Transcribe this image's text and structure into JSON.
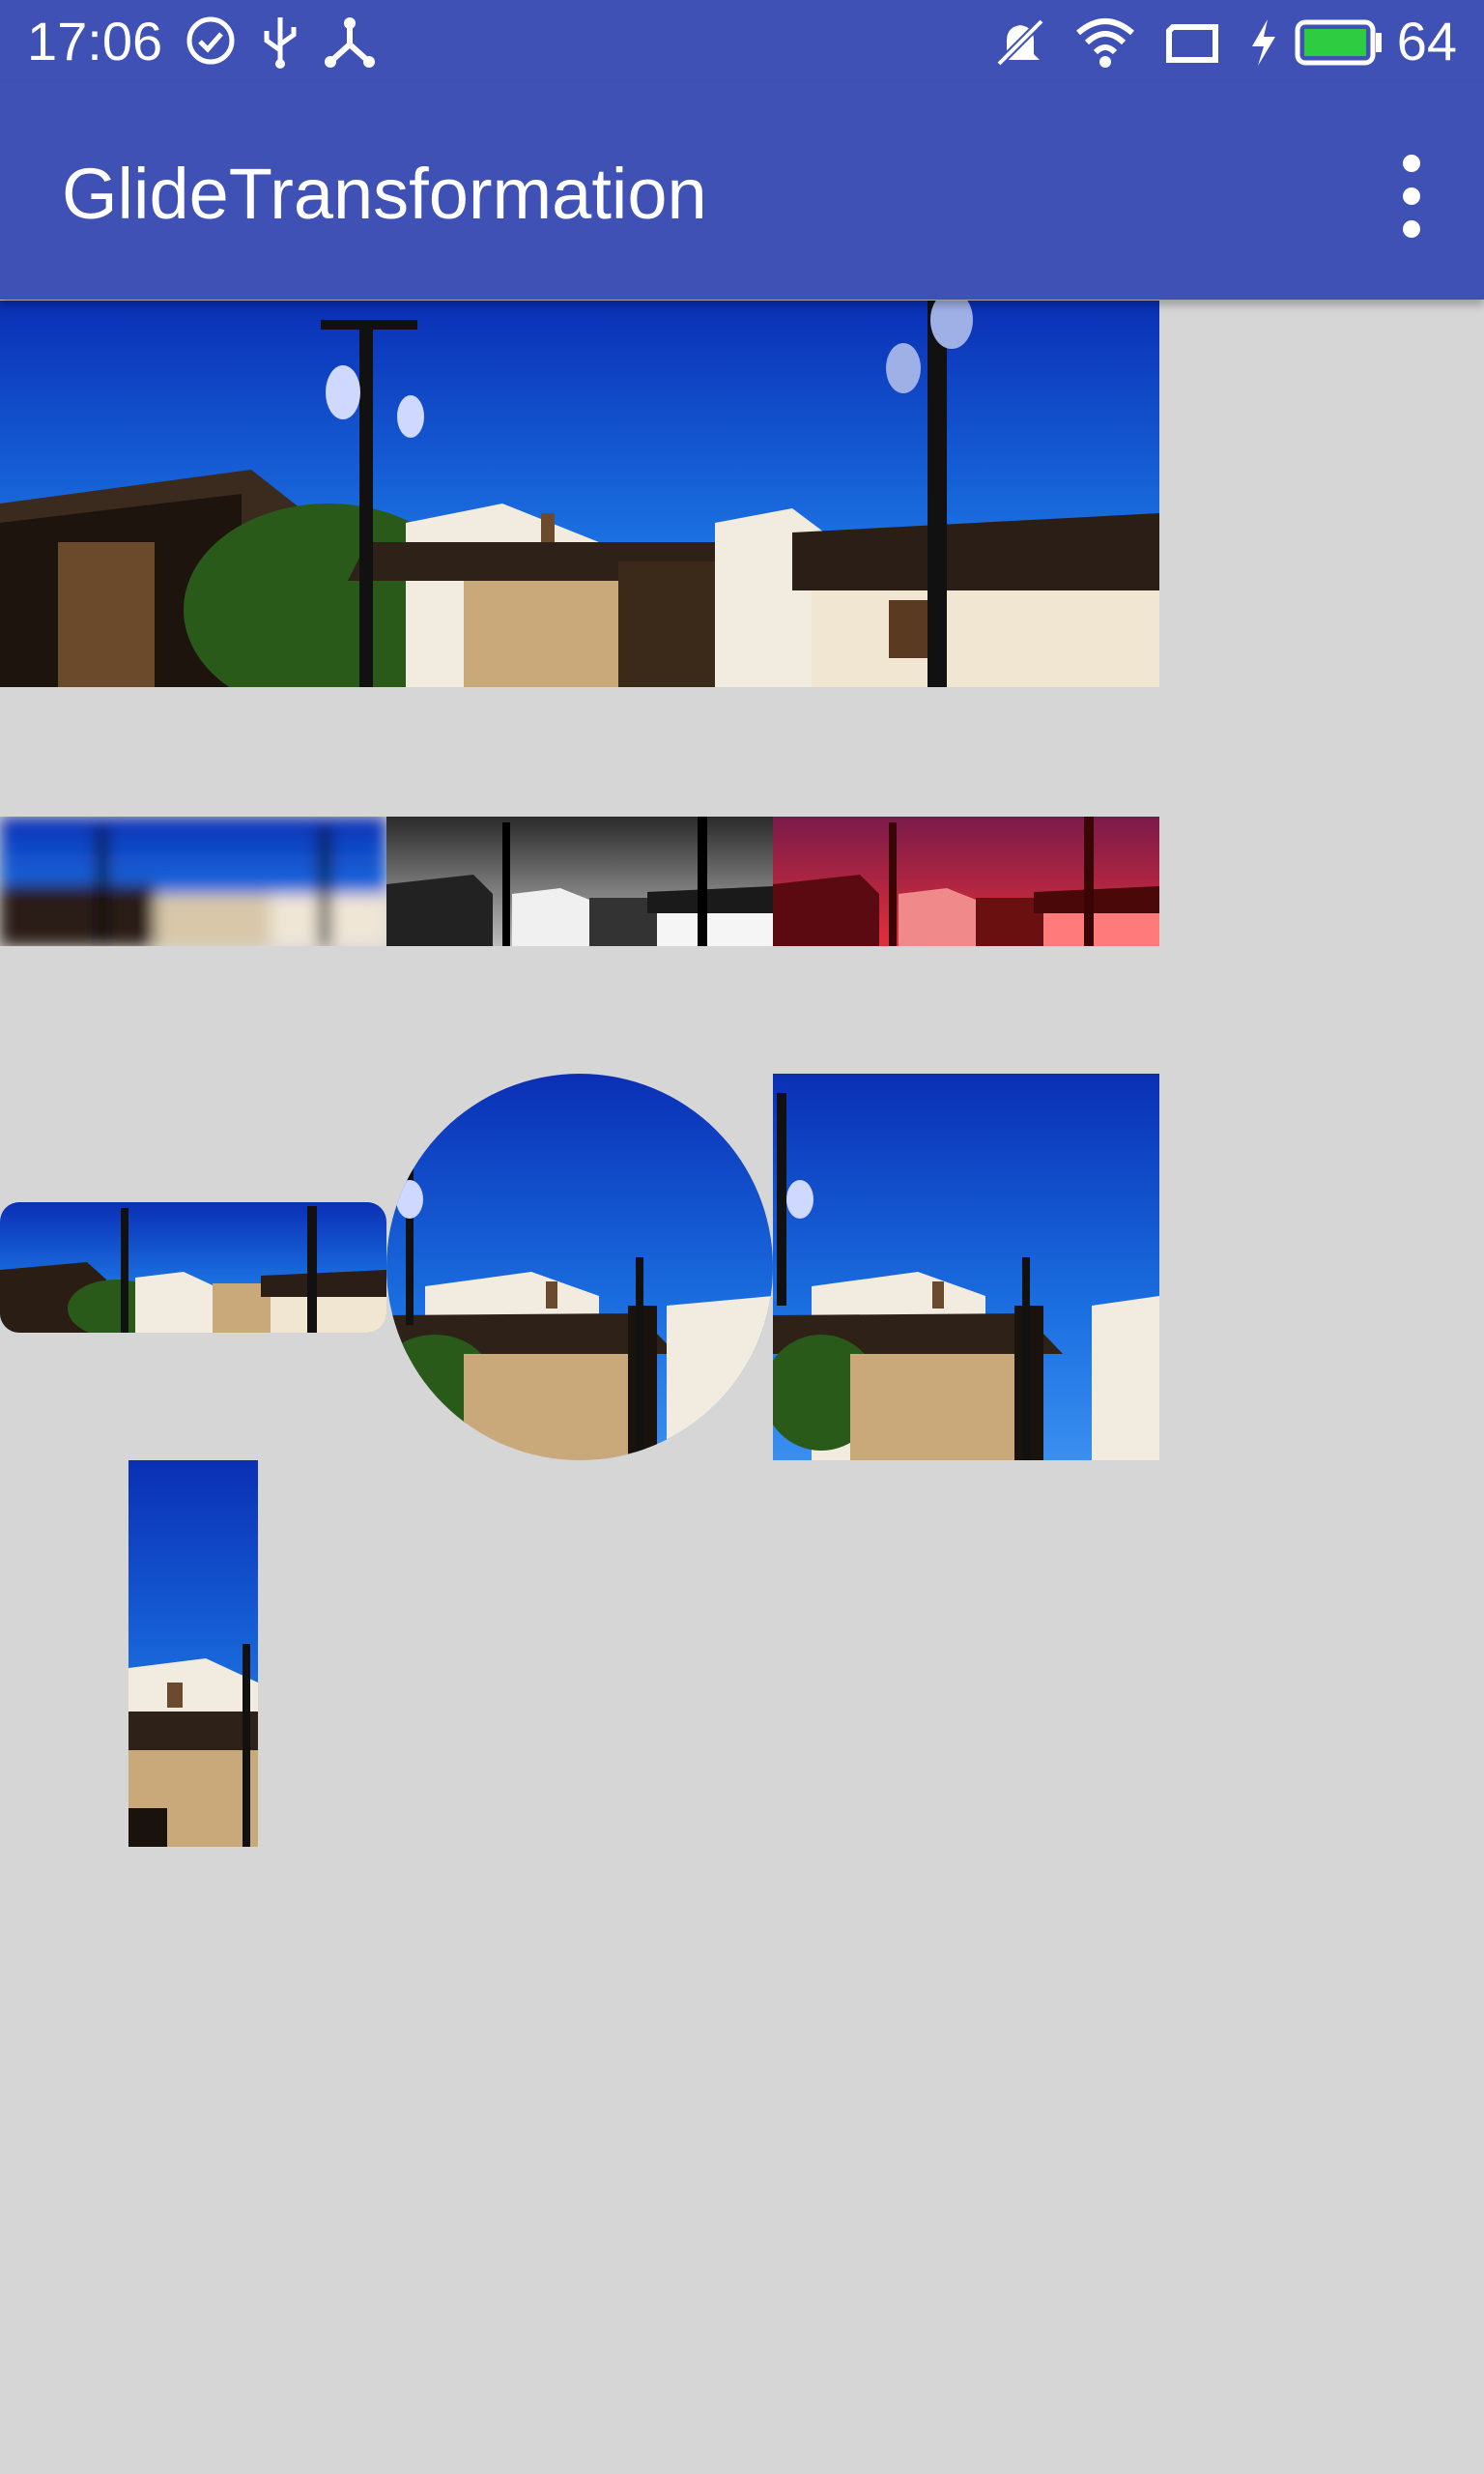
{
  "status_bar": {
    "time": "17:06",
    "battery_level": "64",
    "icons": [
      "check-circle-icon",
      "usb-icon",
      "share-icon",
      "bell-off-icon",
      "wifi-icon",
      "screen-icon",
      "charging-icon",
      "battery-icon"
    ]
  },
  "toolbar": {
    "title": "GlideTransformation",
    "menu_icon": "more-vert-icon"
  },
  "images": [
    {
      "name": "original",
      "transform": "none"
    },
    {
      "name": "blur",
      "transform": "blur"
    },
    {
      "name": "grayscale",
      "transform": "grayscale"
    },
    {
      "name": "color-filter",
      "transform": "red-tint"
    },
    {
      "name": "rounded-corners",
      "transform": "rounded"
    },
    {
      "name": "crop-circle",
      "transform": "circle"
    },
    {
      "name": "crop-square",
      "transform": "square"
    },
    {
      "name": "crop-narrow",
      "transform": "crop"
    }
  ],
  "colors": {
    "primary": "#3f51b5",
    "background": "#d6d6d6",
    "battery": "#2ecc40"
  }
}
